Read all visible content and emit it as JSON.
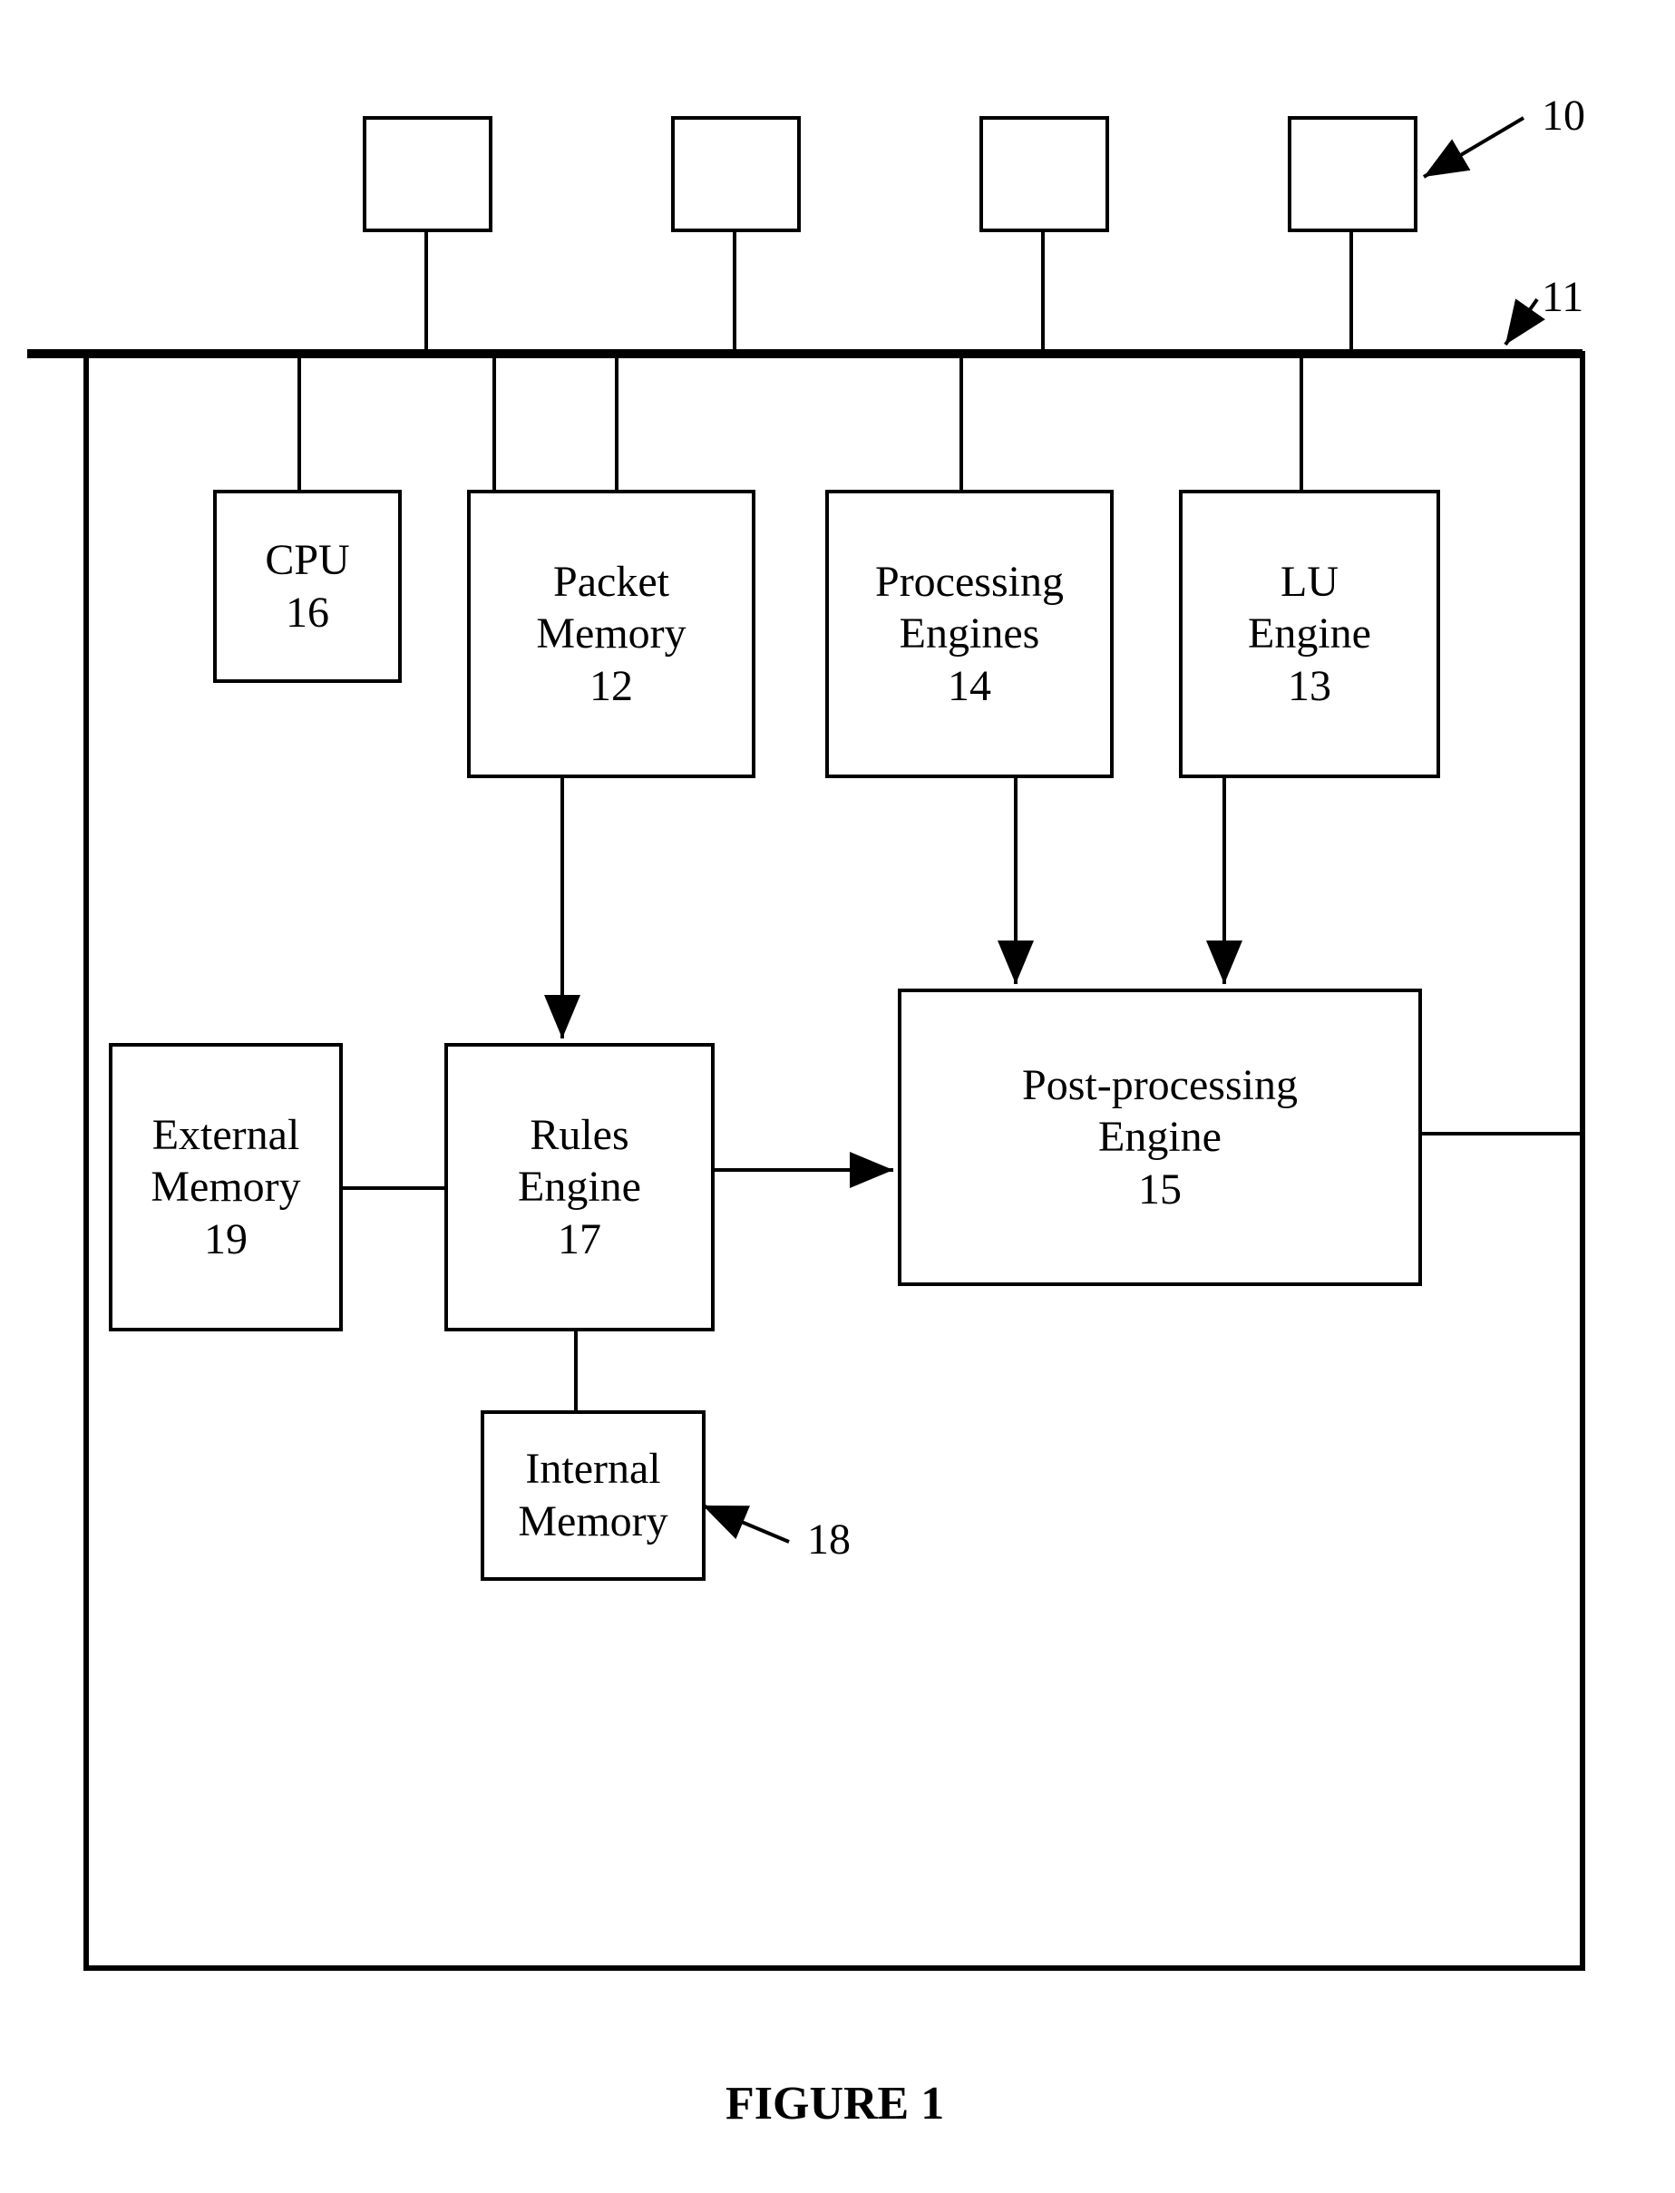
{
  "labels": {
    "ref10": "10",
    "ref11": "11",
    "ref18": "18",
    "figure": "FIGURE 1"
  },
  "blocks": {
    "cpu": {
      "line1": "CPU",
      "line2": "16"
    },
    "packet": {
      "line1": "Packet",
      "line2": "Memory",
      "line3": "12"
    },
    "proc": {
      "line1": "Processing",
      "line2": "Engines",
      "line3": "14"
    },
    "lu": {
      "line1": "LU",
      "line2": "Engine",
      "line3": "13"
    },
    "ext": {
      "line1": "External",
      "line2": "Memory",
      "line3": "19"
    },
    "rules": {
      "line1": "Rules",
      "line2": "Engine",
      "line3": "17"
    },
    "post": {
      "line1": "Post-processing",
      "line2": "Engine",
      "line3": "15"
    },
    "internal": {
      "line1": "Internal",
      "line2": "Memory"
    }
  }
}
